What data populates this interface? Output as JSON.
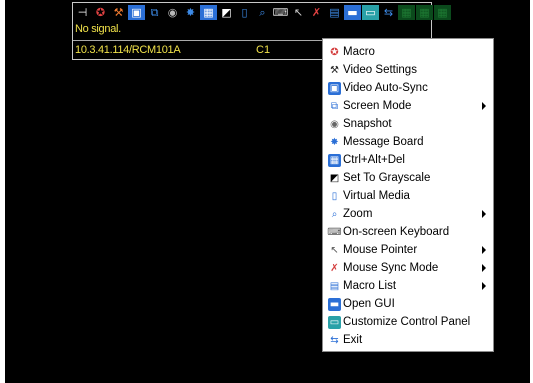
{
  "status": {
    "signal_text": "No signal.",
    "target_name": "10.3.41.114/RCM101A",
    "channel": "C1"
  },
  "toolbar": {
    "icons": [
      {
        "name": "pin-icon",
        "glyph": "⊣",
        "color": "#ffffff",
        "bg": "#000000"
      },
      {
        "name": "macro-icon",
        "glyph": "✪",
        "color": "#e34343",
        "bg": "#000000"
      },
      {
        "name": "video-settings-icon",
        "glyph": "⚒",
        "color": "#f07a30",
        "bg": "#000000"
      },
      {
        "name": "video-autosync-icon",
        "glyph": "▣",
        "color": "#ffffff",
        "bg": "#2b6fd6"
      },
      {
        "name": "screen-mode-icon",
        "glyph": "⧉",
        "color": "#3d8be8",
        "bg": "#000000"
      },
      {
        "name": "snapshot-icon",
        "glyph": "◉",
        "color": "#b8b8b8",
        "bg": "#000000"
      },
      {
        "name": "message-board-icon",
        "glyph": "✸",
        "color": "#3d8be8",
        "bg": "#000000"
      },
      {
        "name": "ctrl-alt-del-icon",
        "glyph": "▦",
        "color": "#ffffff",
        "bg": "#2b6fd6"
      },
      {
        "name": "grayscale-icon",
        "glyph": "◩",
        "color": "#ffffff",
        "bg": "#000000"
      },
      {
        "name": "virtual-media-icon",
        "glyph": "▯",
        "color": "#3d8be8",
        "bg": "#000000"
      },
      {
        "name": "zoom-icon",
        "glyph": "⌕",
        "color": "#3d8be8",
        "bg": "#000000"
      },
      {
        "name": "keyboard-icon",
        "glyph": "⌨",
        "color": "#cfcfcf",
        "bg": "#000000"
      },
      {
        "name": "mouse-pointer-icon",
        "glyph": "↖",
        "color": "#cfcfcf",
        "bg": "#000000"
      },
      {
        "name": "mouse-sync-icon",
        "glyph": "✗",
        "color": "#e34343",
        "bg": "#000000"
      },
      {
        "name": "macro-list-icon",
        "glyph": "▤",
        "color": "#3d8be8",
        "bg": "#000000"
      },
      {
        "name": "open-gui-icon",
        "glyph": "▬",
        "color": "#ffffff",
        "bg": "#2b6fd6"
      },
      {
        "name": "customize-panel-icon",
        "glyph": "▭",
        "color": "#ffffff",
        "bg": "#2aa1a8"
      },
      {
        "name": "exit-icon",
        "glyph": "⇆",
        "color": "#3d8be8",
        "bg": "#000000"
      },
      {
        "name": "green-panel-1-icon",
        "glyph": "▦",
        "color": "#1e7a33",
        "bg": "#0b4a1c"
      },
      {
        "name": "green-panel-2-icon",
        "glyph": "▦",
        "color": "#1e7a33",
        "bg": "#0b4a1c"
      },
      {
        "name": "green-panel-3-icon",
        "glyph": "▦",
        "color": "#1e7a33",
        "bg": "#0b4a1c"
      }
    ]
  },
  "menu": {
    "items": [
      {
        "label": "Macro",
        "icon": "macro-icon",
        "glyph": "✪",
        "color": "#d33c3c",
        "bg": "#ffffff",
        "submenu": false
      },
      {
        "label": "Video Settings",
        "icon": "video-settings-icon",
        "glyph": "⚒",
        "color": "#222222",
        "bg": "#ffffff",
        "submenu": false
      },
      {
        "label": "Video Auto-Sync",
        "icon": "video-autosync-icon",
        "glyph": "▣",
        "color": "#ffffff",
        "bg": "#2b6fd6",
        "submenu": false
      },
      {
        "label": "Screen Mode",
        "icon": "screen-mode-icon",
        "glyph": "⧉",
        "color": "#2b6fd6",
        "bg": "#ffffff",
        "submenu": true
      },
      {
        "label": "Snapshot",
        "icon": "snapshot-icon",
        "glyph": "◉",
        "color": "#666666",
        "bg": "#ffffff",
        "submenu": false
      },
      {
        "label": "Message Board",
        "icon": "message-board-icon",
        "glyph": "✸",
        "color": "#2b6fd6",
        "bg": "#ffffff",
        "submenu": false
      },
      {
        "label": "Ctrl+Alt+Del",
        "icon": "ctrl-alt-del-icon",
        "glyph": "▦",
        "color": "#ffffff",
        "bg": "#2b6fd6",
        "submenu": false
      },
      {
        "label": "Set To Grayscale",
        "icon": "grayscale-icon",
        "glyph": "◩",
        "color": "#000000",
        "bg": "#ffffff",
        "submenu": false
      },
      {
        "label": "Virtual Media",
        "icon": "virtual-media-icon",
        "glyph": "▯",
        "color": "#2b6fd6",
        "bg": "#ffffff",
        "submenu": false
      },
      {
        "label": "Zoom",
        "icon": "zoom-icon",
        "glyph": "⌕",
        "color": "#2b6fd6",
        "bg": "#ffffff",
        "submenu": true
      },
      {
        "label": "On-screen Keyboard",
        "icon": "keyboard-icon",
        "glyph": "⌨",
        "color": "#555555",
        "bg": "#ffffff",
        "submenu": false
      },
      {
        "label": "Mouse Pointer",
        "icon": "mouse-pointer-icon",
        "glyph": "↖",
        "color": "#555555",
        "bg": "#ffffff",
        "submenu": true
      },
      {
        "label": "Mouse Sync Mode",
        "icon": "mouse-sync-icon",
        "glyph": "✗",
        "color": "#d33c3c",
        "bg": "#ffffff",
        "submenu": true
      },
      {
        "label": "Macro List",
        "icon": "macro-list-icon",
        "glyph": "▤",
        "color": "#2b6fd6",
        "bg": "#ffffff",
        "submenu": true
      },
      {
        "label": "Open GUI",
        "icon": "open-gui-icon",
        "glyph": "▬",
        "color": "#ffffff",
        "bg": "#2b6fd6",
        "submenu": false
      },
      {
        "label": "Customize Control Panel",
        "icon": "customize-panel-icon",
        "glyph": "▭",
        "color": "#ffffff",
        "bg": "#2aa1a8",
        "submenu": false
      },
      {
        "label": "Exit",
        "icon": "exit-icon",
        "glyph": "⇆",
        "color": "#2b6fd6",
        "bg": "#ffffff",
        "submenu": false
      }
    ]
  }
}
